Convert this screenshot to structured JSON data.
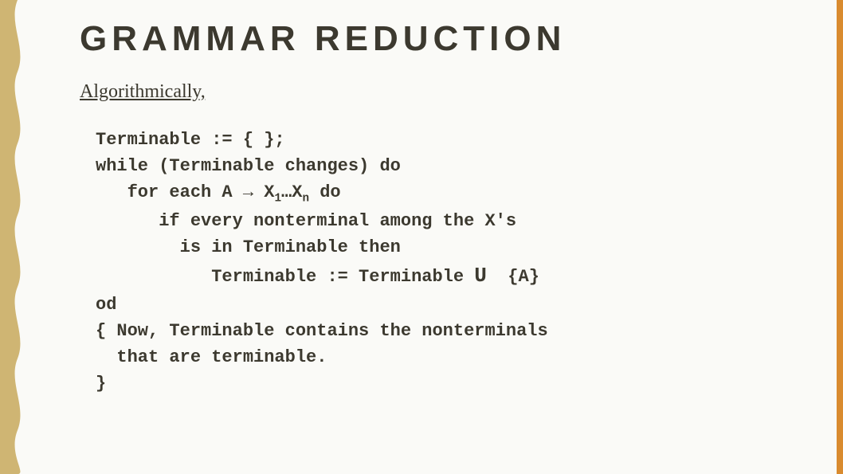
{
  "title": "GRAMMAR REDUCTION",
  "subhead": "Algorithmically,",
  "code": {
    "l1": "Terminable := { };",
    "l2": "while (Terminable changes) do",
    "l3a": "   for each A → X",
    "l3sub1": "1",
    "l3b": "…X",
    "l3subn": "n",
    "l3c": " do",
    "l4": "      if every nonterminal among the X's",
    "l5": "        is in Terminable then",
    "l6a": "           Terminable := Terminable ",
    "l6u": "U",
    "l6b": "  {A}",
    "l7": "od",
    "l8": "{ Now, Terminable contains the nonterminals",
    "l9": "  that are terminable.",
    "l10": "}"
  }
}
